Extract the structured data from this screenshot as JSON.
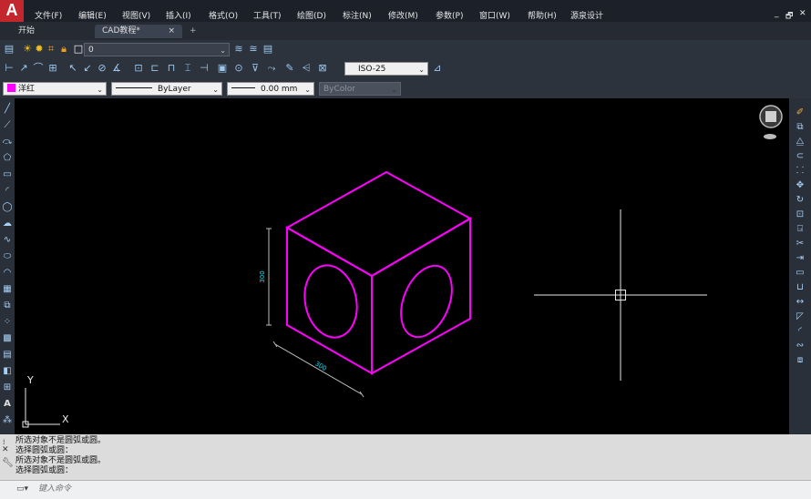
{
  "app": {
    "logo_letter": "A"
  },
  "menu": [
    "文件(F)",
    "编辑(E)",
    "视图(V)",
    "插入(I)",
    "格式(O)",
    "工具(T)",
    "绘图(D)",
    "标注(N)",
    "修改(M)",
    "参数(P)",
    "窗口(W)",
    "帮助(H)",
    "源泉设计"
  ],
  "window_controls": {
    "minimize": "_",
    "restore": "🗗",
    "close": "✕"
  },
  "tabs": {
    "start": "开始",
    "active": "CAD教程*",
    "close": "×",
    "add": "+"
  },
  "layer": {
    "name": "0"
  },
  "dim_style": "ISO-25",
  "properties": {
    "color": "洋红",
    "linetype": "ByLayer",
    "lineweight": "0.00 mm",
    "plotstyle": "ByColor"
  },
  "drawing": {
    "dim_vertical": "300",
    "dim_oblique": "300"
  },
  "ucs": {
    "y": "Y",
    "x": "X"
  },
  "command_history": [
    "所选对象不是圆弧或圆。",
    "选择圆弧或圆：",
    "所选对象不是圆弧或圆。",
    "选择圆弧或圆："
  ],
  "command_input": {
    "placeholder": "键入命令"
  },
  "colors": {
    "magenta": "#ff00ff",
    "cyan": "#00e5ff",
    "canvas": "#000000",
    "crosshair": "#e8e8e8"
  }
}
